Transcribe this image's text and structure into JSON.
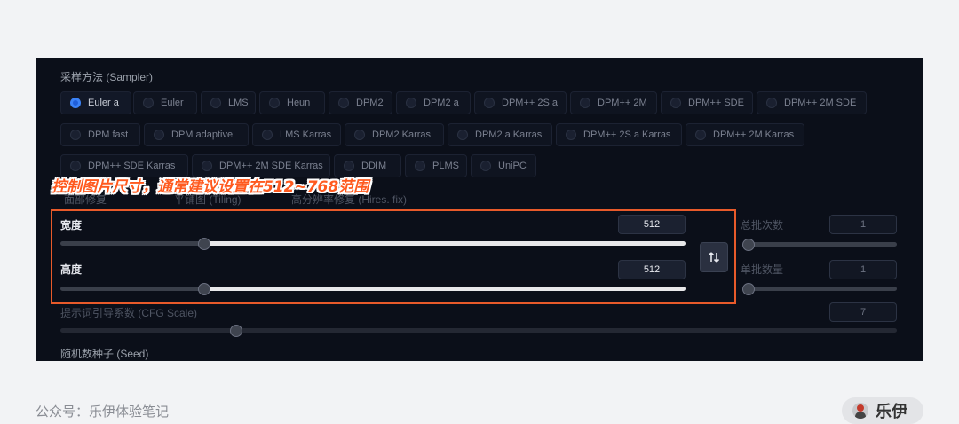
{
  "sampler": {
    "label": "采样方法 (Sampler)",
    "options": [
      {
        "label": "Euler a",
        "selected": true
      },
      {
        "label": "Euler"
      },
      {
        "label": "LMS"
      },
      {
        "label": "Heun"
      },
      {
        "label": "DPM2"
      },
      {
        "label": "DPM2 a"
      },
      {
        "label": "DPM++ 2S a"
      },
      {
        "label": "DPM++ 2M"
      },
      {
        "label": "DPM++ SDE"
      },
      {
        "label": "DPM++ 2M SDE"
      },
      {
        "label": "DPM fast"
      },
      {
        "label": "DPM adaptive"
      },
      {
        "label": "LMS Karras"
      },
      {
        "label": "DPM2 Karras"
      },
      {
        "label": "DPM2 a Karras"
      },
      {
        "label": "DPM++ 2S a Karras"
      },
      {
        "label": "DPM++ 2M Karras"
      },
      {
        "label": "DPM++ SDE Karras"
      },
      {
        "label": "DPM++ 2M SDE Karras"
      },
      {
        "label": "DDIM"
      },
      {
        "label": "PLMS"
      },
      {
        "label": "UniPC"
      }
    ]
  },
  "checkboxes": {
    "face_restore": "面部修复",
    "tiling": "平铺图 (Tiling)",
    "hires_fix": "高分辨率修复 (Hires. fix)"
  },
  "annotation": "控制图片尺寸，通常建议设置在512~768范围",
  "width": {
    "label": "宽度",
    "value": "512",
    "level": 0.23
  },
  "height": {
    "label": "高度",
    "value": "512",
    "level": 0.23
  },
  "swap_icon": "swap-icon",
  "batch_count": {
    "label": "总批次数",
    "value": "1"
  },
  "batch_size": {
    "label": "单批数量",
    "value": "1"
  },
  "cfg_scale": {
    "label": "提示词引导系数 (CFG Scale)",
    "value": "7",
    "level": 0.21
  },
  "seed": {
    "label": "随机数种子 (Seed)"
  },
  "footer": {
    "account": "公众号：乐伊体验笔记",
    "author": "乐伊"
  },
  "colors": {
    "accent": "#3b82f6",
    "highlight": "#e85a2a",
    "annotation": "#ff5a1f",
    "panel_bg": "#0b0f19"
  }
}
